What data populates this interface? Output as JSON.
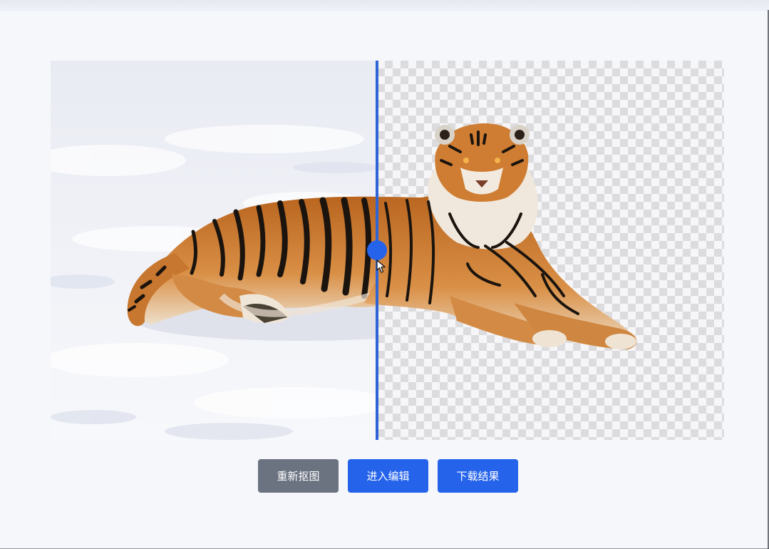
{
  "viewer": {
    "split_position": 0.485,
    "icons": {
      "handle": "drag-handle-icon",
      "cursor": "mouse-pointer-icon"
    },
    "images": {
      "original": "tiger-lying-in-snow",
      "result": "tiger-background-removed"
    }
  },
  "actions": {
    "redo_label": "重新抠图",
    "edit_label": "进入编辑",
    "download_label": "下载结果"
  },
  "colors": {
    "accent": "#2563eb",
    "divider": "#2f64d6",
    "secondary_button": "#6b7280",
    "page_background": "#f5f7fb",
    "checker_light": "#f6f6f8",
    "checker_dark": "#dcdcde"
  }
}
